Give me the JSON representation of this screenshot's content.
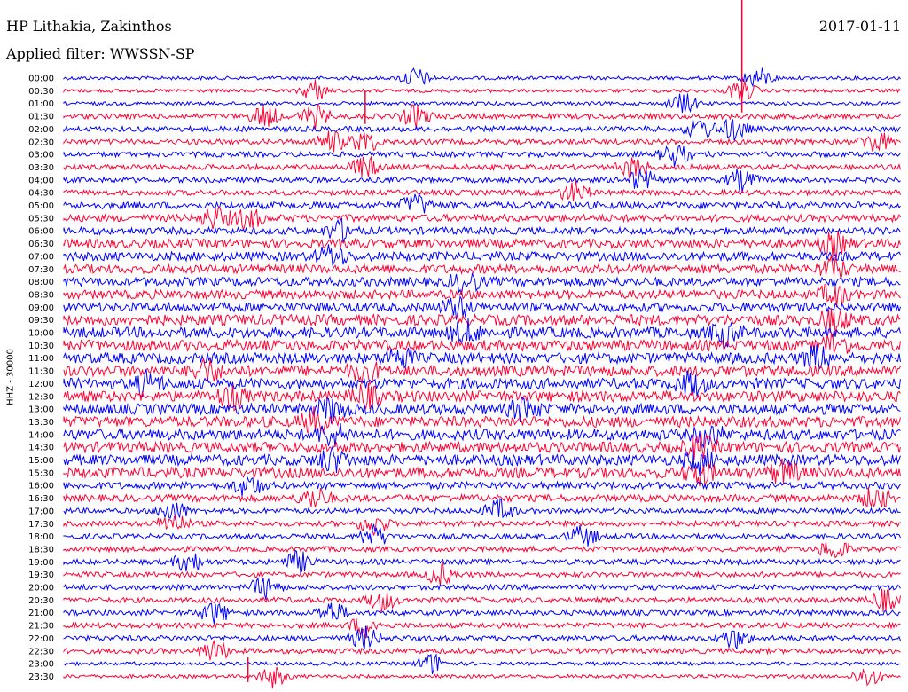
{
  "header": {
    "station": "HP Lithakia, Zakinthos",
    "date": "2017-01-11",
    "filter": "Applied filter: WWSSN-SP",
    "channel": "HHZ - 30000"
  },
  "chart_data": {
    "type": "line",
    "title": "HP Lithakia, Zakinthos",
    "subtitle": "Applied filter: WWSSN-SP",
    "ylabel": "HHZ - 30000",
    "colors": [
      "#0000ff",
      "#ff0033"
    ],
    "rows": [
      {
        "time": "00:00",
        "color": "#0000ff",
        "amplitude": 2,
        "events": [
          0.42,
          0.83
        ]
      },
      {
        "time": "00:30",
        "color": "#ff0033",
        "amplitude": 2,
        "events": [
          0.3,
          0.81
        ]
      },
      {
        "time": "01:00",
        "color": "#0000ff",
        "amplitude": 2,
        "events": [
          0.74
        ]
      },
      {
        "time": "01:30",
        "color": "#ff0033",
        "amplitude": 3,
        "events": [
          0.24,
          0.3,
          0.42
        ]
      },
      {
        "time": "02:00",
        "color": "#0000ff",
        "amplitude": 3,
        "events": [
          0.76,
          0.8
        ]
      },
      {
        "time": "02:30",
        "color": "#ff0033",
        "amplitude": 3,
        "events": [
          0.32,
          0.36,
          0.97
        ]
      },
      {
        "time": "03:00",
        "color": "#0000ff",
        "amplitude": 3,
        "events": [
          0.73
        ]
      },
      {
        "time": "03:30",
        "color": "#ff0033",
        "amplitude": 3,
        "events": [
          0.36,
          0.68
        ]
      },
      {
        "time": "04:00",
        "color": "#0000ff",
        "amplitude": 3,
        "events": [
          0.69,
          0.81
        ]
      },
      {
        "time": "04:30",
        "color": "#ff0033",
        "amplitude": 3,
        "events": [
          0.61
        ]
      },
      {
        "time": "05:00",
        "color": "#0000ff",
        "amplitude": 4,
        "events": [
          0.42
        ]
      },
      {
        "time": "05:30",
        "color": "#ff0033",
        "amplitude": 4,
        "events": [
          0.18,
          0.22
        ]
      },
      {
        "time": "06:00",
        "color": "#0000ff",
        "amplitude": 4,
        "events": [
          0.33
        ]
      },
      {
        "time": "06:30",
        "color": "#ff0033",
        "amplitude": 5,
        "events": [
          0.92
        ]
      },
      {
        "time": "07:00",
        "color": "#0000ff",
        "amplitude": 5,
        "events": [
          0.32
        ]
      },
      {
        "time": "07:30",
        "color": "#ff0033",
        "amplitude": 5,
        "events": [
          0.92
        ]
      },
      {
        "time": "08:00",
        "color": "#0000ff",
        "amplitude": 5,
        "events": [
          0.48
        ]
      },
      {
        "time": "08:30",
        "color": "#ff0033",
        "amplitude": 5,
        "events": [
          0.92
        ]
      },
      {
        "time": "09:00",
        "color": "#0000ff",
        "amplitude": 5,
        "events": [
          0.47
        ]
      },
      {
        "time": "09:30",
        "color": "#ff0033",
        "amplitude": 6,
        "events": [
          0.92
        ]
      },
      {
        "time": "10:00",
        "color": "#0000ff",
        "amplitude": 6,
        "events": [
          0.48,
          0.79
        ]
      },
      {
        "time": "10:30",
        "color": "#ff0033",
        "amplitude": 6,
        "events": [
          0.92
        ]
      },
      {
        "time": "11:00",
        "color": "#0000ff",
        "amplitude": 6,
        "events": [
          0.4,
          0.9
        ]
      },
      {
        "time": "11:30",
        "color": "#ff0033",
        "amplitude": 6,
        "events": [
          0.17,
          0.36
        ]
      },
      {
        "time": "12:00",
        "color": "#0000ff",
        "amplitude": 6,
        "events": [
          0.1,
          0.75
        ]
      },
      {
        "time": "12:30",
        "color": "#ff0033",
        "amplitude": 6,
        "events": [
          0.2,
          0.36
        ]
      },
      {
        "time": "13:00",
        "color": "#0000ff",
        "amplitude": 6,
        "events": [
          0.32,
          0.55
        ]
      },
      {
        "time": "13:30",
        "color": "#ff0033",
        "amplitude": 6,
        "events": [
          0.3
        ]
      },
      {
        "time": "14:00",
        "color": "#0000ff",
        "amplitude": 6,
        "events": [
          0.32,
          0.77
        ]
      },
      {
        "time": "14:30",
        "color": "#ff0033",
        "amplitude": 6,
        "events": [
          0.76
        ]
      },
      {
        "time": "15:00",
        "color": "#0000ff",
        "amplitude": 6,
        "events": [
          0.32,
          0.76
        ]
      },
      {
        "time": "15:30",
        "color": "#ff0033",
        "amplitude": 6,
        "events": [
          0.76,
          0.86
        ]
      },
      {
        "time": "16:00",
        "color": "#0000ff",
        "amplitude": 4,
        "events": [
          0.22
        ]
      },
      {
        "time": "16:30",
        "color": "#ff0033",
        "amplitude": 4,
        "events": [
          0.3,
          0.97
        ]
      },
      {
        "time": "17:00",
        "color": "#0000ff",
        "amplitude": 3,
        "events": [
          0.13,
          0.52
        ]
      },
      {
        "time": "17:30",
        "color": "#ff0033",
        "amplitude": 3,
        "events": [
          0.13,
          0.37
        ]
      },
      {
        "time": "18:00",
        "color": "#0000ff",
        "amplitude": 3,
        "events": [
          0.37,
          0.62
        ]
      },
      {
        "time": "18:30",
        "color": "#ff0033",
        "amplitude": 3,
        "events": [
          0.92
        ]
      },
      {
        "time": "19:00",
        "color": "#0000ff",
        "amplitude": 3,
        "events": [
          0.15,
          0.28
        ]
      },
      {
        "time": "19:30",
        "color": "#ff0033",
        "amplitude": 3,
        "events": [
          0.45
        ]
      },
      {
        "time": "20:00",
        "color": "#0000ff",
        "amplitude": 3,
        "events": [
          0.24
        ]
      },
      {
        "time": "20:30",
        "color": "#ff0033",
        "amplitude": 3,
        "events": [
          0.38,
          0.98
        ]
      },
      {
        "time": "21:00",
        "color": "#0000ff",
        "amplitude": 3,
        "events": [
          0.18,
          0.32
        ]
      },
      {
        "time": "21:30",
        "color": "#ff0033",
        "amplitude": 3,
        "events": [
          0.36
        ]
      },
      {
        "time": "22:00",
        "color": "#0000ff",
        "amplitude": 3,
        "events": [
          0.36,
          0.8
        ]
      },
      {
        "time": "22:30",
        "color": "#ff0033",
        "amplitude": 3,
        "events": [
          0.18
        ]
      },
      {
        "time": "23:00",
        "color": "#0000ff",
        "amplitude": 2,
        "events": [
          0.44
        ]
      },
      {
        "time": "23:30",
        "color": "#ff0033",
        "amplitude": 2,
        "events": [
          0.25,
          0.96
        ]
      }
    ],
    "large_spikes": [
      {
        "time": "00:00",
        "x": 0.81,
        "height": 9
      },
      {
        "time": "01:30",
        "x": 0.36,
        "height": 2
      },
      {
        "time": "23:30",
        "x": 0.22,
        "height": 1.5
      }
    ]
  }
}
